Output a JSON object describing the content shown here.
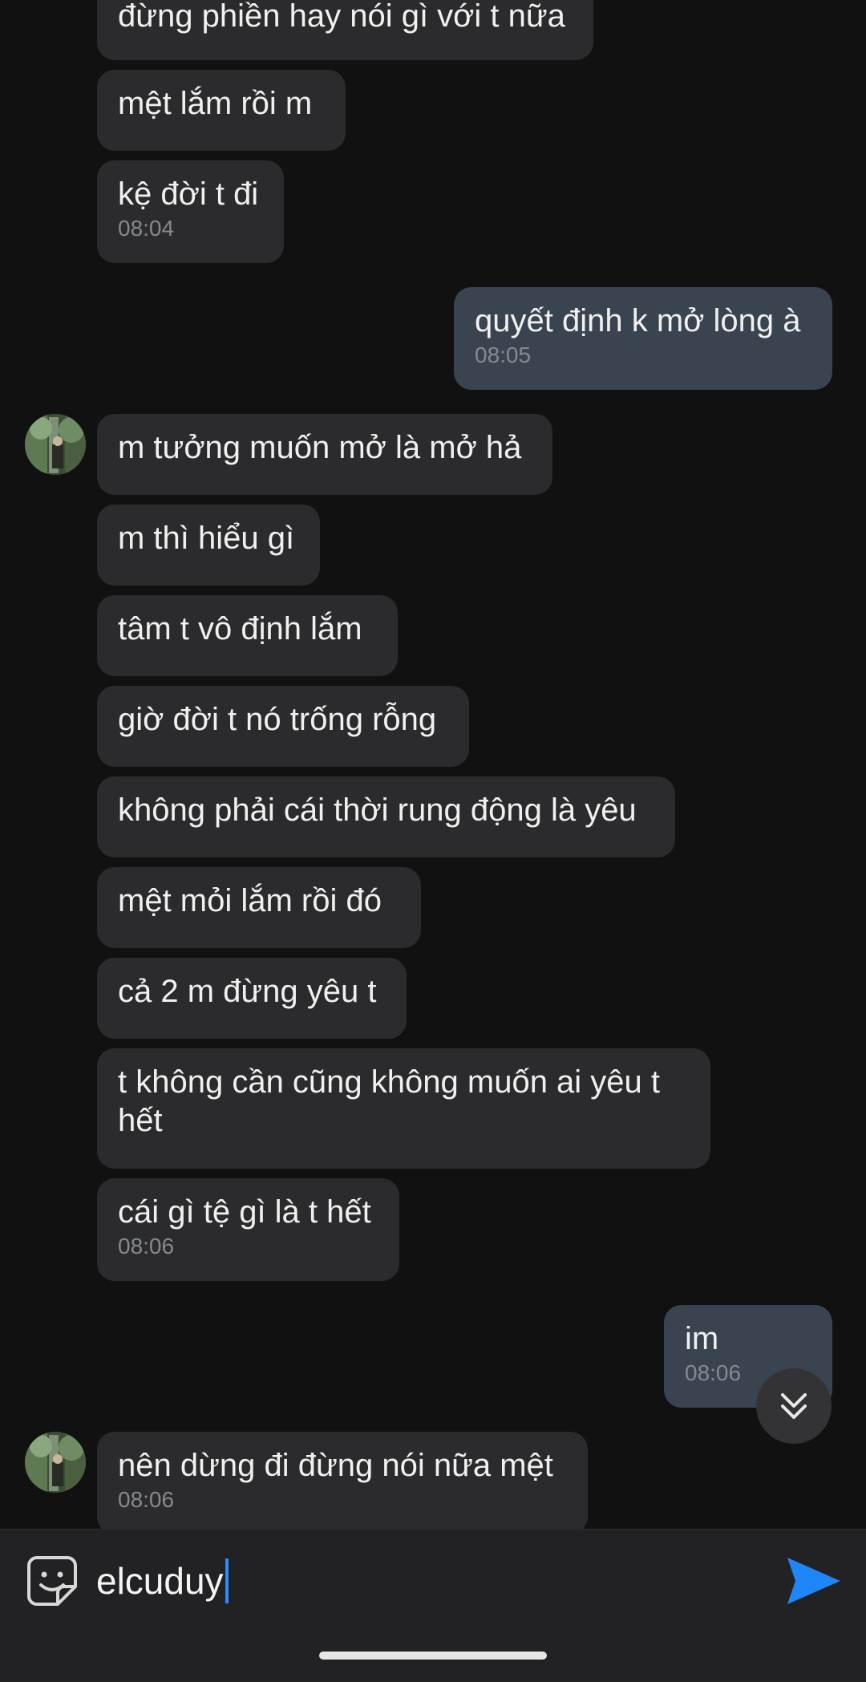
{
  "messages": [
    {
      "text": "đừng phiền hay nói gì với t nữa"
    },
    {
      "text": "mệt lắm rồi m"
    },
    {
      "text": "kệ đời t đi",
      "time": "08:04"
    },
    {
      "text": "quyết định k mở lòng à",
      "time": "08:05"
    },
    {
      "text": "m tưởng muốn mở là mở hả"
    },
    {
      "text": "m thì hiểu gì"
    },
    {
      "text": "tâm t vô định lắm"
    },
    {
      "text": "giờ đời t nó trống rỗng"
    },
    {
      "text": "không phải cái thời rung động là yêu"
    },
    {
      "text": "mệt mỏi lắm rồi đó"
    },
    {
      "text": "cả 2 m đừng yêu t"
    },
    {
      "text": "t không cần cũng không muốn ai yêu t hết"
    },
    {
      "text": "cái gì tệ gì là t hết",
      "time": "08:06"
    },
    {
      "text": "im",
      "time": "08:06"
    },
    {
      "text": "nên dừng đi đừng nói nữa mệt",
      "time": "08:06"
    }
  ],
  "composer": {
    "value": "elcuduy"
  },
  "icons": {
    "emoji": "sticker-emoji-icon",
    "send": "send-arrow-icon",
    "scroll_down": "double-chevron-down-icon"
  },
  "colors": {
    "background": "#111112",
    "incoming_bubble": "#2b2b2d",
    "outgoing_bubble": "#3a4350",
    "timestamp": "#858a90",
    "accent": "#2d8cff"
  }
}
